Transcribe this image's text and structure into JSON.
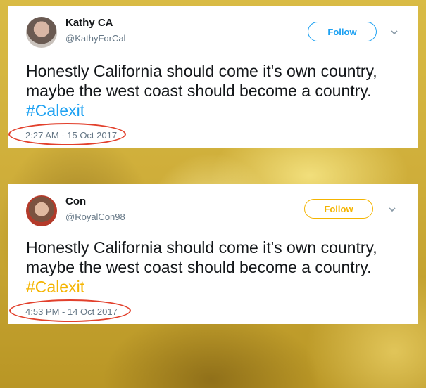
{
  "tweets": [
    {
      "display_name": "Kathy CA",
      "handle": "@KathyForCal",
      "follow_label": "Follow",
      "text_main": "Honestly California should come it's own country, maybe the west coast should become a country.  ",
      "hashtag": "#Calexit",
      "timestamp": "2:27 AM - 15 Oct 2017",
      "accent_color": "#1da1f2"
    },
    {
      "display_name": "Con",
      "handle": "@RoyalCon98",
      "follow_label": "Follow",
      "text_main": "Honestly California should come it's own country, maybe the west coast should become a country.  ",
      "hashtag": "#Calexit",
      "timestamp": "4:53 PM - 14 Oct 2017",
      "accent_color": "#f4b400"
    }
  ],
  "icons": {
    "menu": "chevron-down-icon",
    "highlight": "red-circle-annotation"
  }
}
